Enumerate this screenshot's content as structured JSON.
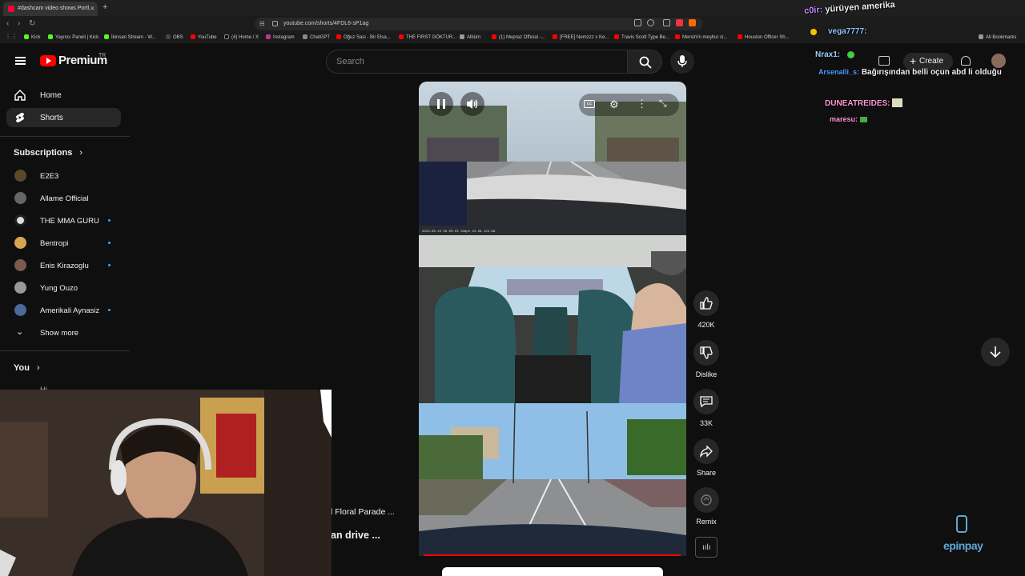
{
  "browser": {
    "tab_title": "#dashcam video shows Portl...",
    "url": "youtube.com/shorts/4FDL6-sP1ag",
    "all_bookmarks_label": "All Bookmarks",
    "bookmarks": [
      "Kick",
      "Yayıncı Paneli | Kick",
      "İkinsan Stream - W...",
      "OBS",
      "YouTube",
      "(4) Home / X",
      "Instagram",
      "ChatGPT",
      "Oğuz Sasi - Bir Elsa...",
      "THE FIRST GÖKTUR...",
      "Albüm",
      "(1) Mepraz Official -...",
      "[FREE] Nemzzz x Ke...",
      "Travis Scott Type Be...",
      "Mersin'in meşhur ci...",
      "Houston Officer Sh..."
    ]
  },
  "header": {
    "logo_text": "Premium",
    "region": "TR",
    "search_placeholder": "Search",
    "create_label": "Create"
  },
  "sidebar": {
    "main": [
      {
        "label": "Home",
        "icon": "home-icon"
      },
      {
        "label": "Shorts",
        "icon": "shorts-icon"
      }
    ],
    "subscriptions_title": "Subscriptions",
    "subscriptions": [
      {
        "name": "E2E3",
        "live": false,
        "color": "#5a4a2a"
      },
      {
        "name": "Allame Official",
        "live": false,
        "color": "#666666"
      },
      {
        "name": "THE MMA GURU",
        "live": true,
        "color": "#dddddd"
      },
      {
        "name": "Bentropi",
        "live": true,
        "color": "#d9a550"
      },
      {
        "name": "Enis Kirazoglu",
        "live": true,
        "color": "#7a5a50"
      },
      {
        "name": "Yung Ouzo",
        "live": false,
        "color": "#999999"
      },
      {
        "name": "Amerikali Aynasiz",
        "live": true,
        "color": "#4a6a9a"
      }
    ],
    "show_more": "Show more",
    "you_title": "You",
    "cut_item": "Hi"
  },
  "video": {
    "title_line1": "l Floral Parade ...",
    "title_line2": "an drive ...",
    "progress_percent": 96,
    "dashcam_timestamp": "2023-06-10 08:00:03  16mph  44.0N  123.0W"
  },
  "actions": {
    "like_count": "420K",
    "dislike_label": "Dislike",
    "comment_count": "33K",
    "share_label": "Share",
    "remix_label": "Remix"
  },
  "chat": {
    "messages": [
      {
        "user": "c0ir:",
        "text": "yürüyen amerika",
        "user_color": "#c58cff"
      },
      {
        "user": "vega7777:",
        "text": "",
        "user_color": "#8fc7ff"
      },
      {
        "user": "Nrax1:",
        "text": "",
        "user_color": "#9fd0ff"
      },
      {
        "user": "Arsenalli_s:",
        "text": "Bağırışından belli oçun abd li olduğu",
        "user_color": "#4ea0ff"
      },
      {
        "user": "DUNEATREIDES:",
        "text": "",
        "user_color": "#ff9ad6"
      },
      {
        "user": "maresu:",
        "text": "",
        "user_color": "#ff9ad6"
      }
    ]
  },
  "overlay": {
    "sponsor": "epinpay"
  }
}
